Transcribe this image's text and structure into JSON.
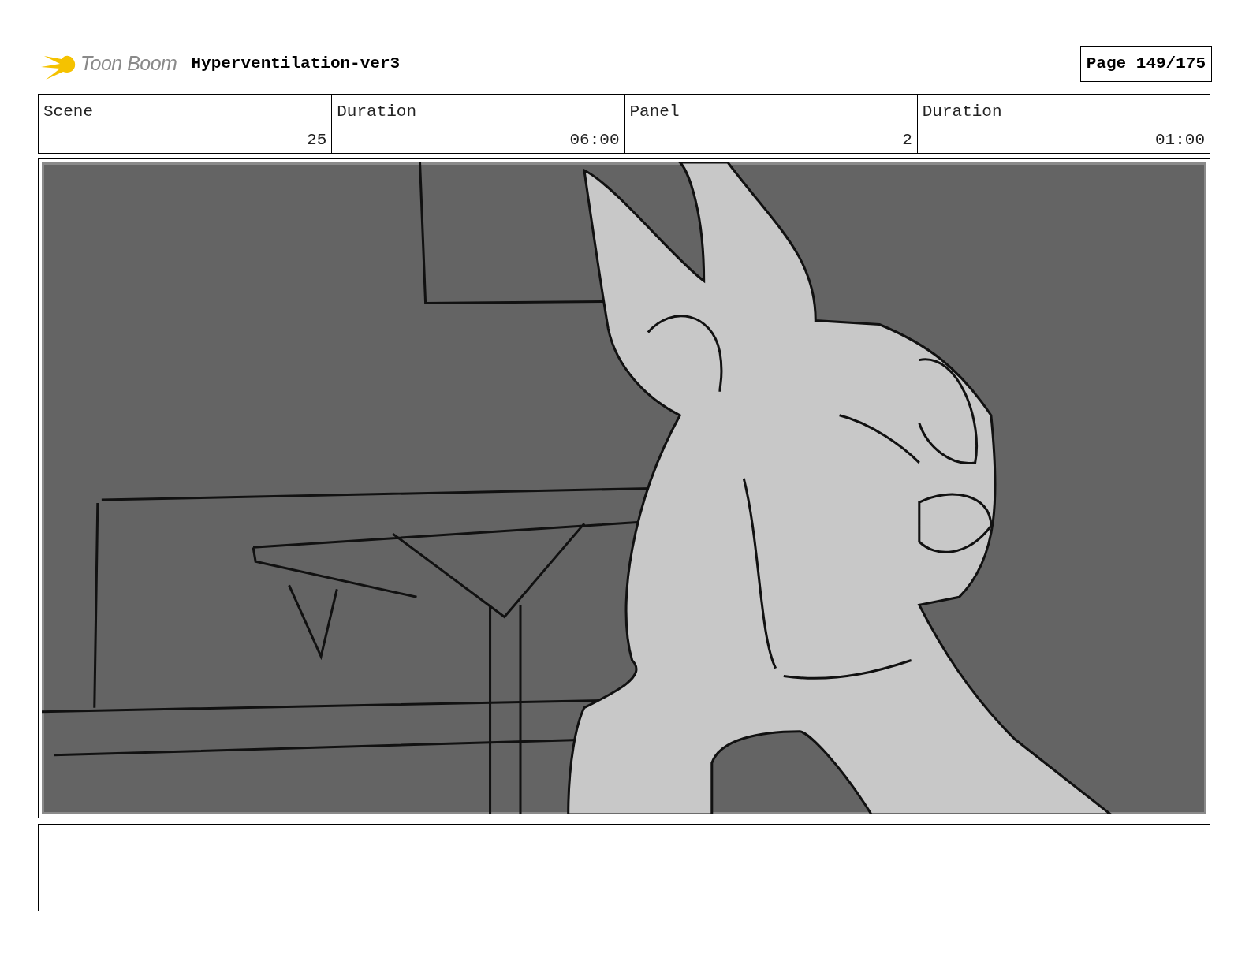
{
  "header": {
    "logo_text": "Toon Boom",
    "project_title": "Hyperventilation-ver3",
    "page": "Page 149/175"
  },
  "info_table": {
    "columns": [
      "Scene",
      "Duration",
      "Panel",
      "Duration"
    ],
    "rows": [
      [
        "25",
        "06:00",
        "2",
        "01:00"
      ]
    ]
  }
}
